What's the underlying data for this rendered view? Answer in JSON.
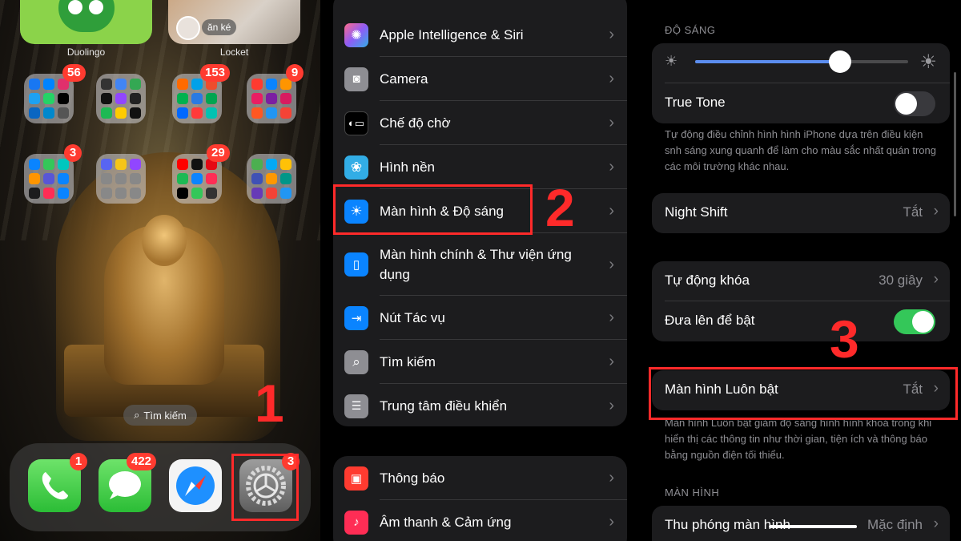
{
  "home": {
    "widgets": [
      {
        "label": "Duolingo"
      },
      {
        "label": "Locket",
        "chip": "ăn ké"
      }
    ],
    "folder_badges": [
      "56",
      "",
      "153",
      "9",
      "3",
      "",
      "29",
      ""
    ],
    "search_label": "Tìm kiếm",
    "dock": [
      {
        "name": "Phone",
        "badge": "1"
      },
      {
        "name": "Messages",
        "badge": "422"
      },
      {
        "name": "Safari",
        "badge": ""
      },
      {
        "name": "Settings",
        "badge": "3"
      }
    ],
    "step": "1"
  },
  "settings": {
    "group1": [
      {
        "label": "Apple Intelligence & Siri",
        "icon": "siri-icon",
        "color": "#8e5cf6"
      },
      {
        "label": "Camera",
        "icon": "camera-icon",
        "color": "#8e8e93"
      },
      {
        "label": "Chế độ chờ",
        "icon": "standby-icon",
        "color": "#1c1c1e"
      },
      {
        "label": "Hình nền",
        "icon": "wallpaper-icon",
        "color": "#32ade6"
      },
      {
        "label": "Màn hình & Độ sáng",
        "icon": "brightness-icon",
        "color": "#0a84ff"
      },
      {
        "label": "Màn hình chính & Thư viện ứng dụng",
        "icon": "home-screen-icon",
        "color": "#0a84ff"
      },
      {
        "label": "Nút Tác vụ",
        "icon": "action-button-icon",
        "color": "#0a84ff"
      },
      {
        "label": "Tìm kiếm",
        "icon": "search-icon",
        "color": "#8e8e93"
      },
      {
        "label": "Trung tâm điều khiển",
        "icon": "control-center-icon",
        "color": "#8e8e93"
      }
    ],
    "group2": [
      {
        "label": "Thông báo",
        "icon": "notifications-icon",
        "color": "#ff3b30"
      },
      {
        "label": "Âm thanh & Cảm ứng",
        "icon": "sounds-icon",
        "color": "#ff2d55"
      }
    ],
    "step": "2"
  },
  "display": {
    "brightness_title": "ĐỘ SÁNG",
    "brightness_level": 0.68,
    "true_tone_label": "True Tone",
    "true_tone_on": false,
    "true_tone_note": "Tự động điều chỉnh hình hình iPhone dựa trên điều kiện snh sáng xung quanh để làm cho màu sắc nhất quán trong các môi trường khác nhau.",
    "night_shift_label": "Night Shift",
    "night_shift_value": "Tắt",
    "auto_lock_label": "Tự động khóa",
    "auto_lock_value": "30 giây",
    "raise_label": "Đưa lên để bật",
    "raise_on": true,
    "always_on_label": "Màn hình Luôn bật",
    "always_on_value": "Tắt",
    "always_on_note": "Màn hình Luôn bật giảm độ sáng hình hình khoá trong khi hiển thị các thông tin như thời gian, tiện ích và thông báo bằng nguồn điện tối thiểu.",
    "screen_title": "MÀN HÌNH",
    "zoom_label": "Thu phóng màn hình",
    "zoom_value": "Mặc định",
    "step": "3",
    "accent_green": "#34c759"
  }
}
